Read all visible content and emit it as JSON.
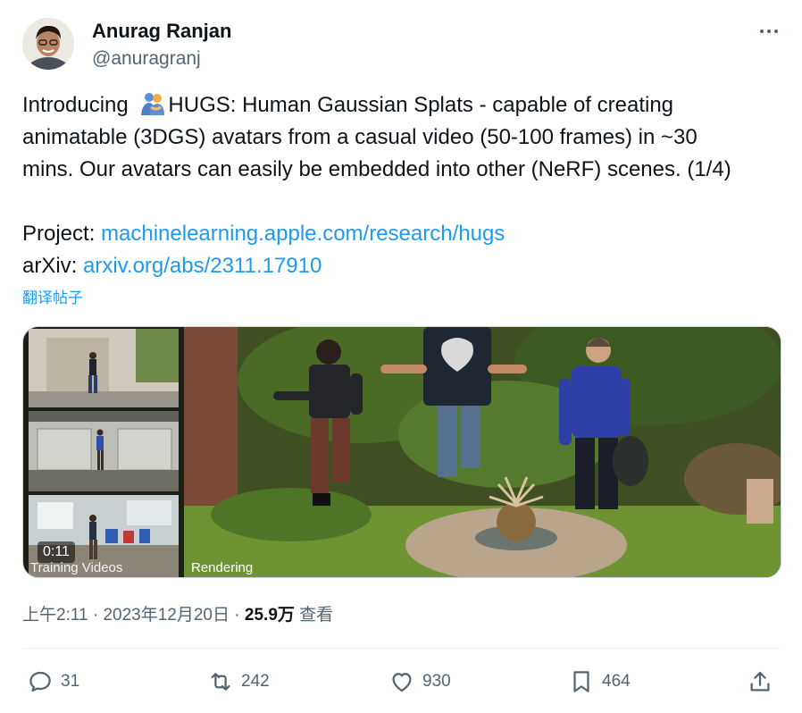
{
  "author": {
    "display_name": "Anurag Ranjan",
    "handle": "@anuragranj"
  },
  "tweet": {
    "line1_before_emoji": "Introducing ",
    "emoji": "people-hugging",
    "line1_after_emoji": "HUGS: Human Gaussian Splats - capable of creating",
    "line2": "animatable (3DGS) avatars from a casual video (50-100 frames) in ~30",
    "line3": "mins. Our avatars can easily be embedded into other (NeRF) scenes. (1/4)",
    "project_label": "Project: ",
    "project_link": "machinelearning.apple.com/research/hugs",
    "arxiv_label": "arXiv: ",
    "arxiv_link": "arxiv.org/abs/2311.17910",
    "translate_label": "翻译帖子"
  },
  "media": {
    "timer": "0:11",
    "label_left": "Training Videos",
    "label_right": "Rendering"
  },
  "meta": {
    "time": "上午2:11",
    "separator": " · ",
    "date": "2023年12月20日",
    "views_count": "25.9万",
    "views_label": " 查看"
  },
  "actions": {
    "reply": "31",
    "repost": "242",
    "like": "930",
    "bookmark": "464"
  },
  "colors": {
    "link": "#1d9bf0",
    "secondary_text": "#536471",
    "primary_text": "#0f1419"
  }
}
